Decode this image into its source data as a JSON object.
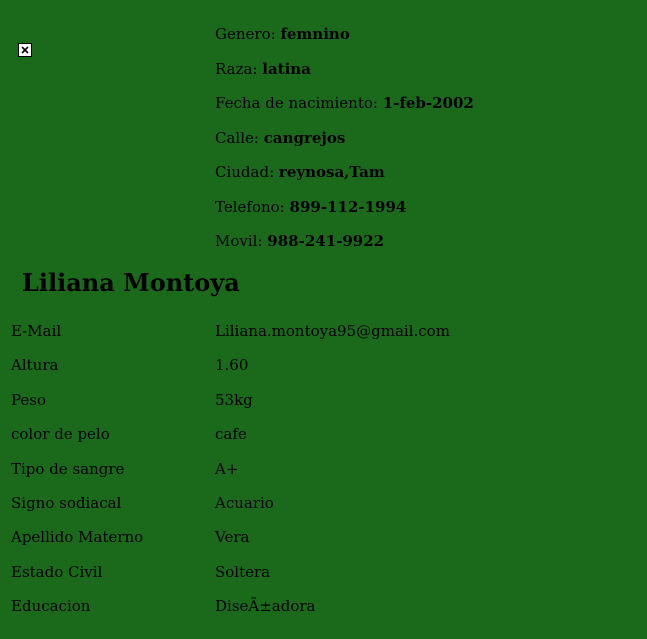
{
  "profile": {
    "name": "Liliana Montoya",
    "top_info": [
      {
        "label": "Genero:",
        "value": "femnino"
      },
      {
        "label": "Raza:",
        "value": "latina"
      },
      {
        "label": "Fecha de nacimiento:",
        "value": "1-feb-2002"
      },
      {
        "label": "Calle:",
        "value": "cangrejos"
      },
      {
        "label": "Ciudad:",
        "value": "reynosa,Tam"
      },
      {
        "label": "Telefono:",
        "value": "899-112-1994"
      },
      {
        "label": "Movil:",
        "value": "988-241-9922"
      }
    ],
    "details": [
      {
        "key": "E-Mail",
        "value": "Liliana.montoya95@gmail.com"
      },
      {
        "key": "Altura",
        "value": "1.60"
      },
      {
        "key": "Peso",
        "value": "53kg"
      },
      {
        "key": "color de pelo",
        "value": "cafe"
      },
      {
        "key": "Tipo de sangre",
        "value": "A+"
      },
      {
        "key": "Signo sodiacal",
        "value": "Acuario"
      },
      {
        "key": "Apellido Materno",
        "value": "Vera"
      },
      {
        "key": "Estado Civil",
        "value": "Soltera"
      },
      {
        "key": "Educacion",
        "value": "DiseÃ±adora"
      }
    ]
  },
  "colors": {
    "background": "#1b6a1c",
    "text": "#000000"
  },
  "icons": {
    "photo": "broken-image-icon"
  }
}
